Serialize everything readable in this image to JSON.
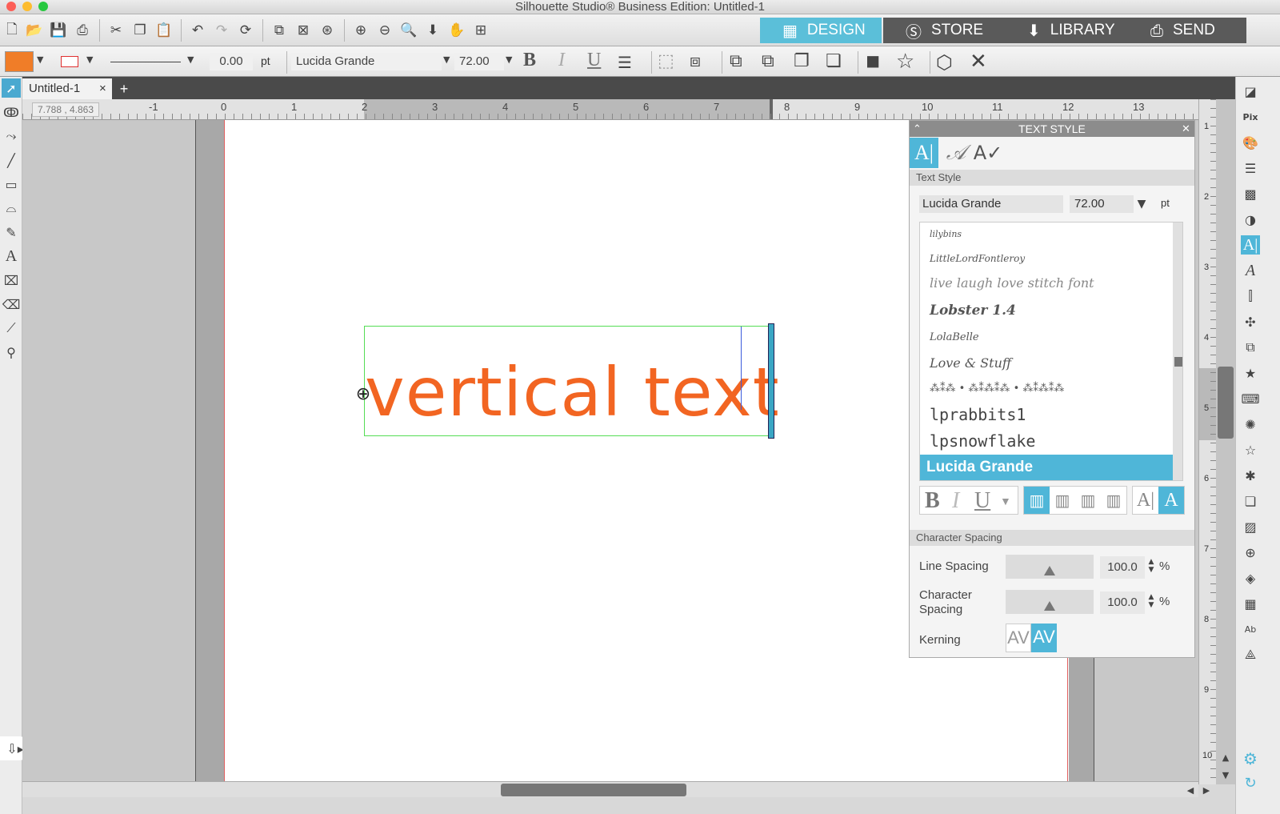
{
  "window": {
    "title": "Silhouette Studio® Business Edition: Untitled-1"
  },
  "nav_tabs": [
    {
      "label": "DESIGN"
    },
    {
      "label": "STORE"
    },
    {
      "label": "LIBRARY"
    },
    {
      "label": "SEND"
    }
  ],
  "toolbar": {
    "fill_color": "#f07d28",
    "line_color": "#e03030",
    "line_width": "0.00",
    "line_unit": "pt",
    "font_name": "Lucida Grande",
    "font_size": "72.00",
    "bold": "B",
    "italic": "I",
    "underline": "U"
  },
  "doc_tab": {
    "label": "Untitled-1",
    "close": "×",
    "add": "+"
  },
  "coords": "7.788 , 4.863",
  "ruler_labels": [
    "-1",
    "0",
    "1",
    "2",
    "3",
    "4",
    "5",
    "6",
    "7",
    "8",
    "9",
    "10",
    "11",
    "12",
    "13"
  ],
  "vruler_labels": [
    "1",
    "2",
    "3",
    "4",
    "5",
    "6",
    "7",
    "8",
    "9",
    "10"
  ],
  "canvas": {
    "text": "vertical text",
    "text_color": "#f26522"
  },
  "panel": {
    "title": "TEXT STYLE",
    "section_text_style": "Text Style",
    "font": "Lucida Grande",
    "size": "72.00",
    "unit": "pt",
    "font_list": [
      "lilybins",
      "LittleLordFontleroy",
      "live laugh love stitch font",
      "Lobster 1.4",
      "LolaBelle",
      "Love & Stuff",
      "⁂⁑⁂ • ⁂⁑⁂⁑⁂ • ⁂⁑⁂⁑⁂",
      "lprabbits1",
      "lpsnowflake",
      "Lucida Grande"
    ],
    "selected_font": "Lucida Grande",
    "section_spacing": "Character Spacing",
    "line_spacing_label": "Line Spacing",
    "line_spacing": "100.0",
    "char_spacing_label_1": "Character",
    "char_spacing_label_2": "Spacing",
    "char_spacing": "100.0",
    "percent": "%",
    "kerning_label": "Kerning",
    "kern_a": "AV",
    "kern_b": "AV"
  }
}
